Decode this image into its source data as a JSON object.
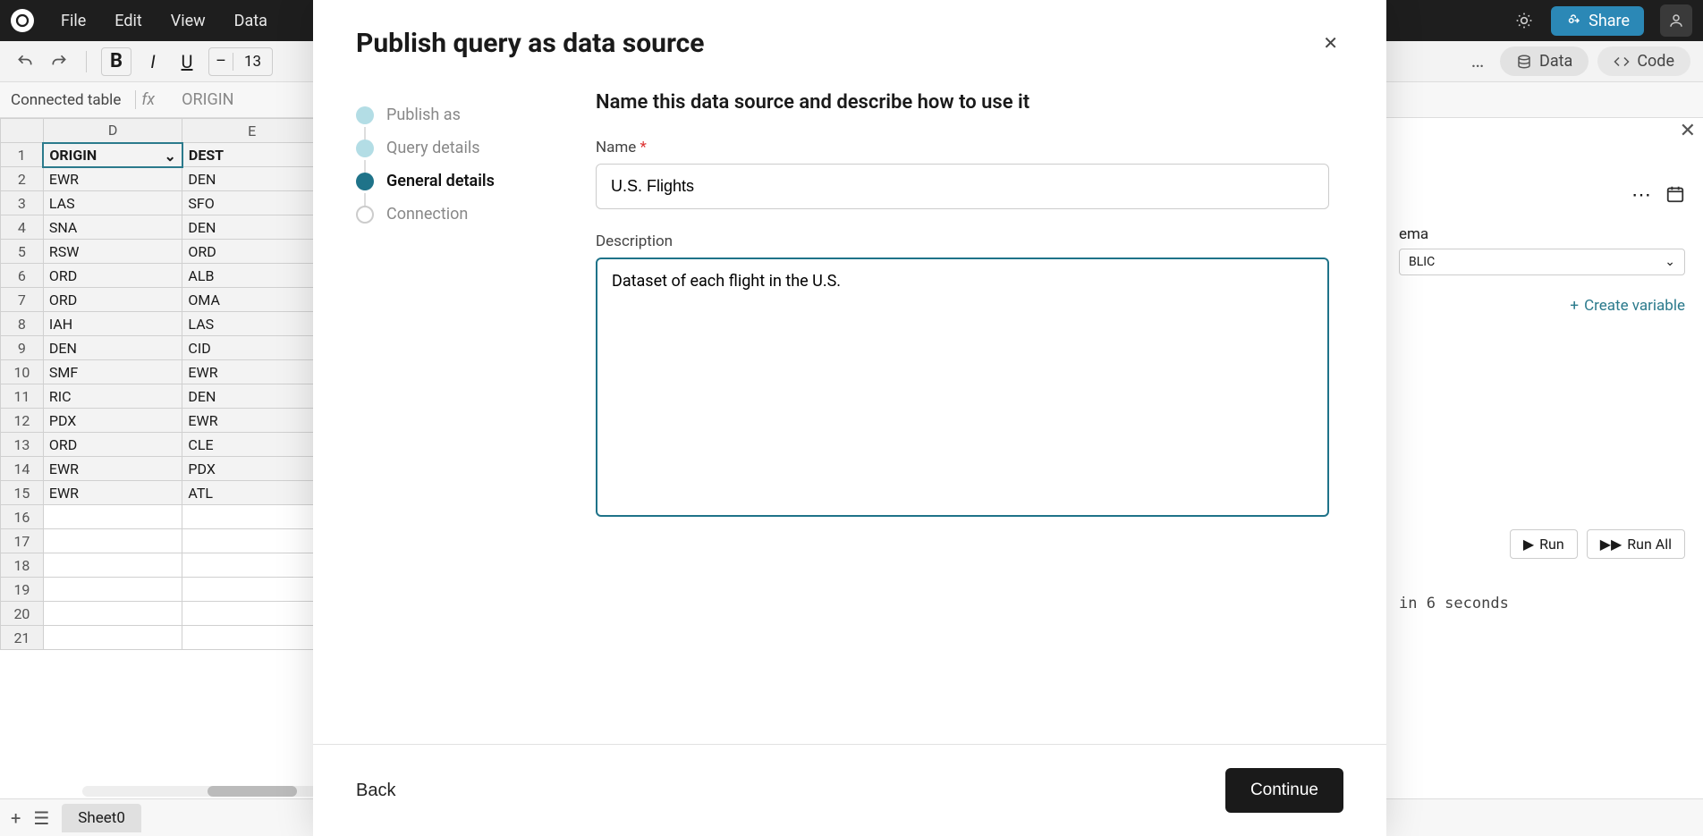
{
  "menubar": {
    "items": [
      "File",
      "Edit",
      "View",
      "Data"
    ],
    "share": "Share"
  },
  "toolbar": {
    "fontsize_minus": "–",
    "fontsize_value": "13",
    "more": "…",
    "data_pill": "Data",
    "code_pill": "Code"
  },
  "formulabar": {
    "label": "Connected table",
    "fx": "fx",
    "value": "ORIGIN"
  },
  "sheet": {
    "cols": [
      "D",
      "E"
    ],
    "headers": [
      "ORIGIN",
      "DEST"
    ],
    "rows": [
      [
        "EWR",
        "DEN"
      ],
      [
        "LAS",
        "SFO"
      ],
      [
        "SNA",
        "DEN"
      ],
      [
        "RSW",
        "ORD"
      ],
      [
        "ORD",
        "ALB"
      ],
      [
        "ORD",
        "OMA"
      ],
      [
        "IAH",
        "LAS"
      ],
      [
        "DEN",
        "CID"
      ],
      [
        "SMF",
        "EWR"
      ],
      [
        "RIC",
        "DEN"
      ],
      [
        "PDX",
        "EWR"
      ],
      [
        "ORD",
        "CLE"
      ],
      [
        "EWR",
        "PDX"
      ],
      [
        "EWR",
        "ATL"
      ]
    ],
    "emptyRows": [
      16,
      17,
      18,
      19,
      20,
      21
    ]
  },
  "rpanel": {
    "schema_label": "ema",
    "schema_value": "BLIC",
    "create_var": "Create variable",
    "run": "Run",
    "run_all": "Run All",
    "status": "in 6 seconds"
  },
  "bottombar": {
    "tab": "Sheet0"
  },
  "modal": {
    "title": "Publish query as data source",
    "steps": [
      "Publish as",
      "Query details",
      "General details",
      "Connection"
    ],
    "active_step": 2,
    "form_heading": "Name this data source and describe how to use it",
    "name_label": "Name",
    "name_value": "U.S. Flights",
    "desc_label": "Description",
    "desc_value": "Dataset of each flight in the U.S.",
    "back": "Back",
    "continue": "Continue"
  }
}
